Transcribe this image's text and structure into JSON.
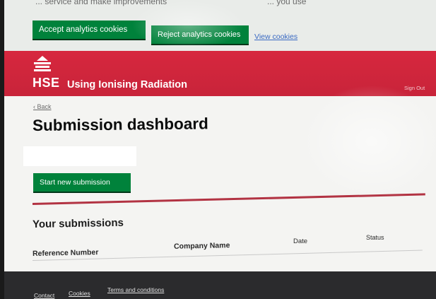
{
  "cookie_banner": {
    "text_left": "... service and make improvements",
    "text_right": "... you use",
    "accept_label": "Accept analytics cookies",
    "reject_label": "Reject analytics cookies",
    "view_label": "View cookies"
  },
  "header": {
    "logo": "HSE",
    "service_name": "Using Ionising Radiation",
    "sign_out": "Sign Out",
    "brand_color": "#d7273e"
  },
  "main": {
    "back_label": "Back",
    "title": "Submission dashboard",
    "start_label": "Start new submission",
    "submissions_title": "Your submissions",
    "table": {
      "columns": [
        "Reference Number",
        "Company Name",
        "Date",
        "Status"
      ],
      "rows": []
    }
  },
  "footer": {
    "links": [
      "Contact",
      "Cookies",
      "Terms and conditions"
    ]
  },
  "colors": {
    "button_green": "#00823b",
    "footer_bg": "#2b2b2d"
  }
}
